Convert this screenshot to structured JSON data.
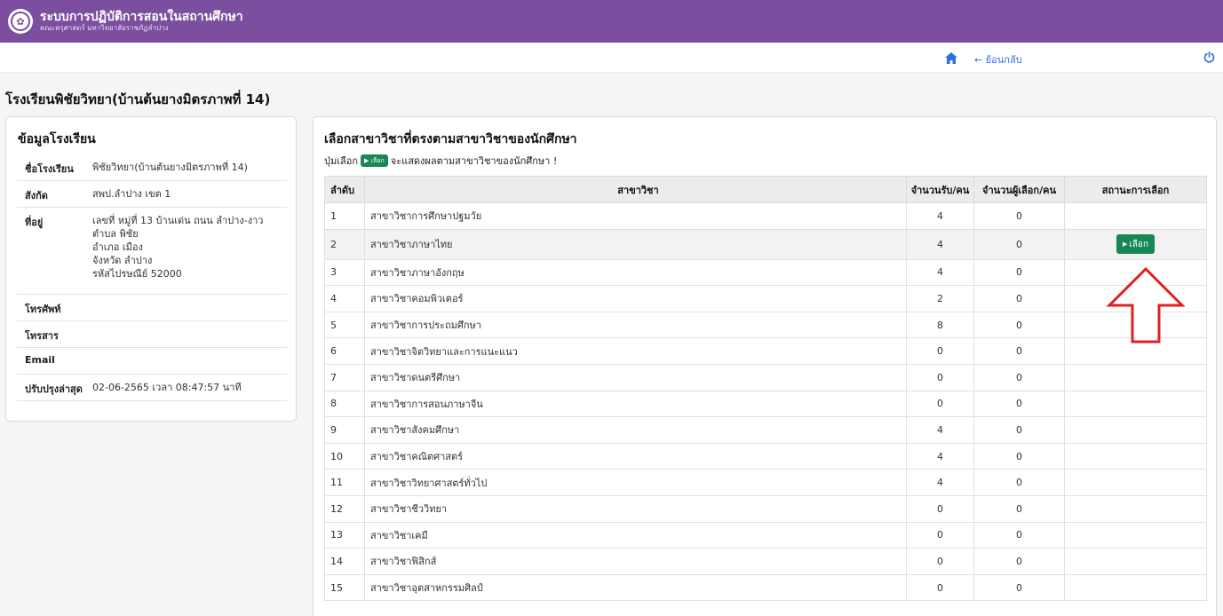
{
  "header": {
    "title": "ระบบการปฏิบัติการสอนในสถานศึกษา",
    "subtitle": "คณะครุศาสตร์ มหาวิทยาลัยราชภัฏลำปาง",
    "logo_icon": "university-seal-icon",
    "color": "#7b4ea0"
  },
  "nav": {
    "back_label": "← ย้อนกลับ",
    "home_icon": "home-icon",
    "power_icon": "power-icon",
    "link_color": "#2f6fe0"
  },
  "page_title": "โรงเรียนพิชัยวิทยา(บ้านต้นยางมิตรภาพที่ 14)",
  "school_info": {
    "heading": "ข้อมูลโรงเรียน",
    "rows": [
      {
        "label": "ชื่อโรงเรียน",
        "lines": [
          "พิชัยวิทยา(บ้านต้นยางมิตรภาพที่ 14)"
        ]
      },
      {
        "label": "สังกัด",
        "lines": [
          "สพป.ลำปาง เขต 1"
        ]
      },
      {
        "label": "ที่อยู่",
        "lines": [
          "เลขที่ หมู่ที่ 13 บ้านเด่น ถนน ลำปาง-งาว",
          "ตำบล พิชัย",
          "อำเภอ เมือง",
          "จังหวัด ลำปาง",
          "รหัสไปรษณีย์ 52000"
        ]
      },
      {
        "label": "โทรศัพท์",
        "lines": [
          ""
        ]
      },
      {
        "label": "โทรสาร",
        "lines": [
          ""
        ]
      },
      {
        "label": "Email",
        "lines": [
          ""
        ]
      },
      {
        "label": "ปรับปรุงล่าสุด",
        "lines": [
          "02-06-2565 เวลา 08:47:57 นาที"
        ]
      }
    ]
  },
  "majors": {
    "heading": "เลือกสาขาวิชาที่ตรงตามสาขาวิชาของนักศึกษา",
    "hint_before": "ปุ่มเลือก",
    "hint_btn": "เลือก",
    "hint_after": "จะแสดงผลตามสาขาวิชาของนักศึกษา !",
    "columns": [
      "ลำดับ",
      "สาขาวิชา",
      "จำนวนรับ/คน",
      "จำนวนผู้เลือก/คน",
      "สถานะการเลือก"
    ],
    "select_label": "เลือก",
    "select_color": "#198754",
    "rows": [
      {
        "no": "1",
        "name": "สาขาวิชาการศึกษาปฐมวัย",
        "cap": "4",
        "chosen": "0",
        "selectable": false
      },
      {
        "no": "2",
        "name": "สาขาวิชาภาษาไทย",
        "cap": "4",
        "chosen": "0",
        "selectable": true
      },
      {
        "no": "3",
        "name": "สาขาวิชาภาษาอังกฤษ",
        "cap": "4",
        "chosen": "0",
        "selectable": false
      },
      {
        "no": "4",
        "name": "สาขาวิชาคอมพิวเตอร์",
        "cap": "2",
        "chosen": "0",
        "selectable": false
      },
      {
        "no": "5",
        "name": "สาขาวิชาการประถมศึกษา",
        "cap": "8",
        "chosen": "0",
        "selectable": false
      },
      {
        "no": "6",
        "name": "สาขาวิชาจิตวิทยาและการแนะแนว",
        "cap": "0",
        "chosen": "0",
        "selectable": false
      },
      {
        "no": "7",
        "name": "สาขาวิชาดนตรีศึกษา",
        "cap": "0",
        "chosen": "0",
        "selectable": false
      },
      {
        "no": "8",
        "name": "สาขาวิชาการสอนภาษาจีน",
        "cap": "0",
        "chosen": "0",
        "selectable": false
      },
      {
        "no": "9",
        "name": "สาขาวิชาสังคมศึกษา",
        "cap": "4",
        "chosen": "0",
        "selectable": false
      },
      {
        "no": "10",
        "name": "สาขาวิชาคณิตศาสตร์",
        "cap": "4",
        "chosen": "0",
        "selectable": false
      },
      {
        "no": "11",
        "name": "สาขาวิชาวิทยาศาสตร์ทั่วไป",
        "cap": "4",
        "chosen": "0",
        "selectable": false
      },
      {
        "no": "12",
        "name": "สาขาวิชาชีววิทยา",
        "cap": "0",
        "chosen": "0",
        "selectable": false
      },
      {
        "no": "13",
        "name": "สาขาวิชาเคมี",
        "cap": "0",
        "chosen": "0",
        "selectable": false
      },
      {
        "no": "14",
        "name": "สาขาวิชาฟิสิกส์",
        "cap": "0",
        "chosen": "0",
        "selectable": false
      },
      {
        "no": "15",
        "name": "สาขาวิชาอุตสาหกรรมศิลป์",
        "cap": "0",
        "chosen": "0",
        "selectable": false
      }
    ]
  },
  "annotation": {
    "icon": "up-arrow-icon",
    "color": "#e02020"
  }
}
